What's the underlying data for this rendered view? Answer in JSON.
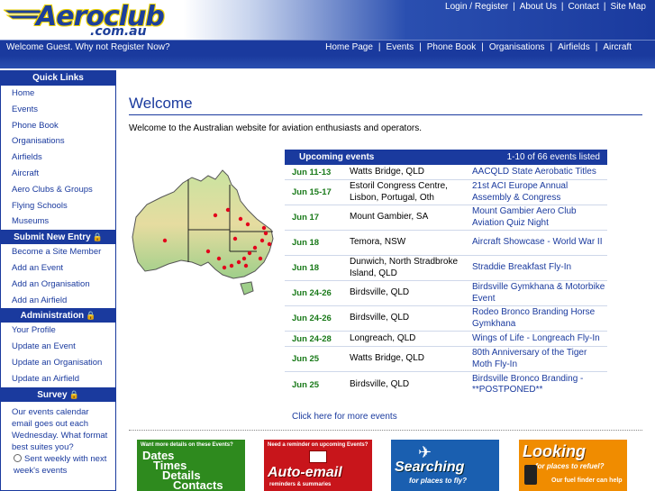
{
  "header": {
    "logo_title": "Aeroclub",
    "logo_sub": ".com.au",
    "top_links": [
      "Login / Register",
      "About Us",
      "Contact",
      "Site Map"
    ]
  },
  "navbar": {
    "welcome": "Welcome Guest.  Why not Register Now?",
    "links": [
      "Home Page",
      "Events",
      "Phone Book",
      "Organisations",
      "Airfields",
      "Aircraft"
    ]
  },
  "sidebar": {
    "quick_links_title": "Quick Links",
    "quick_links": [
      "Home",
      "Events",
      "Phone Book",
      "Organisations",
      "Airfields",
      "Aircraft",
      "Aero Clubs & Groups",
      "Flying Schools",
      "Museums"
    ],
    "submit_title": "Submit New Entry",
    "submit_links": [
      "Become a Site Member",
      "Add an Event",
      "Add an Organisation",
      "Add an Airfield"
    ],
    "admin_title": "Administration",
    "admin_links": [
      "Your Profile",
      "Update an Event",
      "Update an Organisation",
      "Update an Airfield"
    ],
    "survey_title": "Survey",
    "survey_text": "Our events calendar email goes out each Wednesday. What format best suites you?",
    "survey_option": "Sent weekly with next week's events"
  },
  "main": {
    "heading": "Welcome",
    "intro": "Welcome to the Australian website for aviation enthusiasts and operators.",
    "more_events": "Click here for more events"
  },
  "events": {
    "title": "Upcoming events",
    "count": "1-10 of 66 events listed",
    "rows": [
      {
        "date": "Jun 11-13",
        "location": "Watts Bridge, QLD",
        "name": "AACQLD State Aerobatic Titles"
      },
      {
        "date": "Jun 15-17",
        "location": "Estoril Congress Centre, Lisbon, Portugal, Oth",
        "name": "21st ACI Europe Annual Assembly & Congress"
      },
      {
        "date": "Jun 17",
        "location": "Mount Gambier, SA",
        "name": "Mount Gambier Aero Club Aviation Quiz Night"
      },
      {
        "date": "Jun 18",
        "location": "Temora, NSW",
        "name": "Aircraft Showcase - World War II"
      },
      {
        "date": "Jun 18",
        "location": "Dunwich, North Stradbroke Island, QLD",
        "name": "Straddie Breakfast Fly-In"
      },
      {
        "date": "Jun 24-26",
        "location": "Birdsville, QLD",
        "name": "Birdsville Gymkhana & Motorbike Event"
      },
      {
        "date": "Jun 24-26",
        "location": "Birdsville, QLD",
        "name": "Rodeo Bronco Branding Horse Gymkhana"
      },
      {
        "date": "Jun 24-28",
        "location": "Longreach, QLD",
        "name": "Wings of Life - Longreach Fly-In"
      },
      {
        "date": "Jun 25",
        "location": "Watts Bridge, QLD",
        "name": "80th Anniversary of the Tiger Moth Fly-In"
      },
      {
        "date": "Jun 25",
        "location": "Birdsville, QLD",
        "name": "Birdsville Bronco Branding - **POSTPONED**"
      }
    ]
  },
  "banners": {
    "b1_small": "Want more details on these Events?",
    "b1_lines": [
      "Dates",
      "Times",
      "Details",
      "Contacts"
    ],
    "b2_small": "Need a reminder on upcoming Events?",
    "b2_big": "Auto-email",
    "b2_sub": "reminders & summaries",
    "b3_big": "Searching",
    "b3_sub": "for places to fly?",
    "b4_big": "Looking",
    "b4_sub": "for places to refuel?",
    "b4_sub2": "Our fuel finder can help"
  },
  "colors": {
    "brand_blue": "#1a3a9e",
    "event_date_green": "#1a7a1a",
    "logo_yellow": "#f0d400"
  }
}
